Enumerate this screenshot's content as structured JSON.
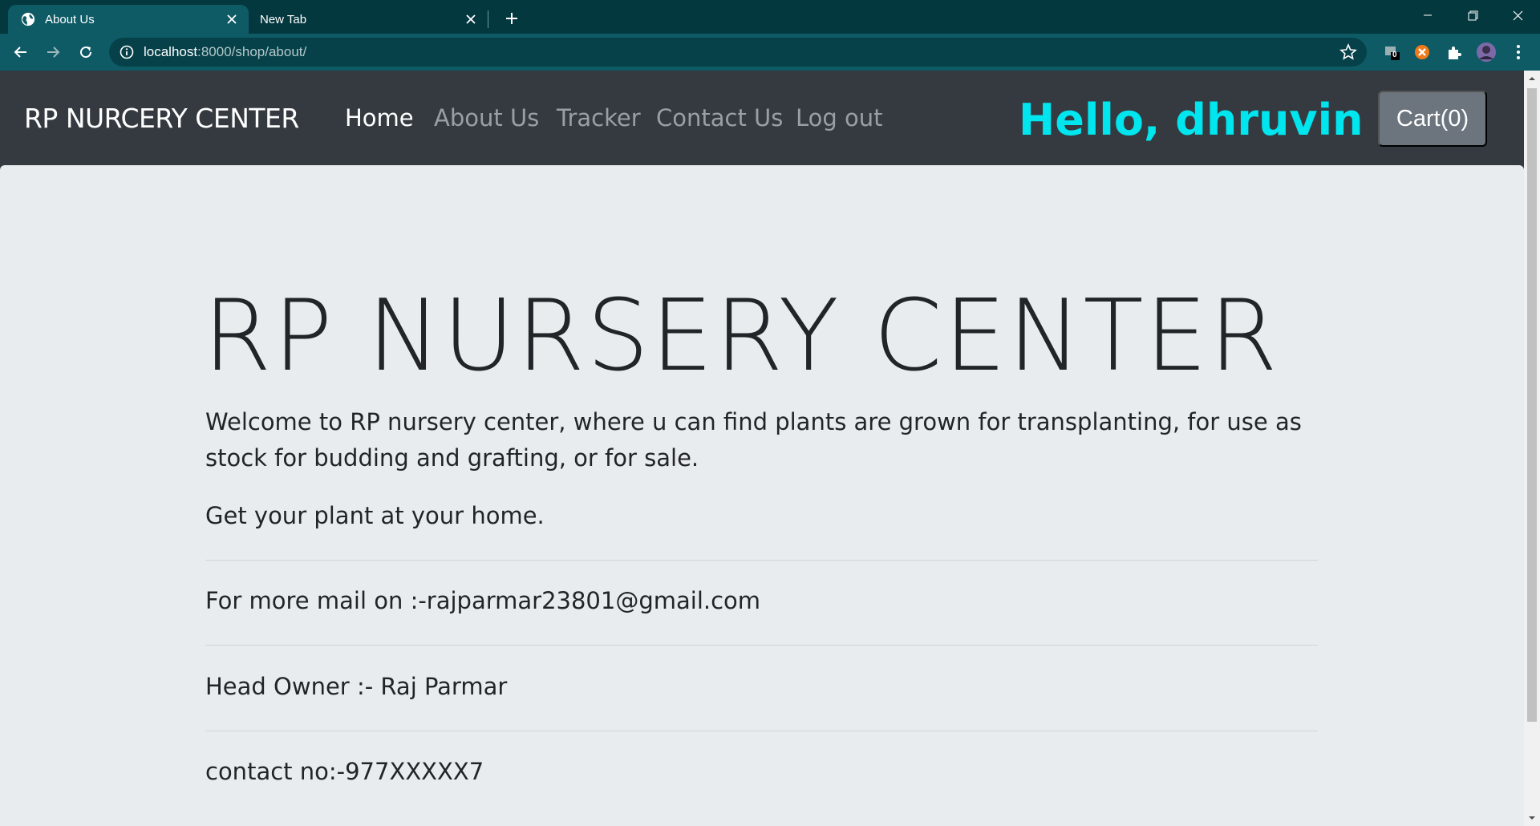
{
  "browser": {
    "tabs": [
      {
        "title": "About Us",
        "active": true
      },
      {
        "title": "New Tab",
        "active": false
      }
    ],
    "url_host": "localhost",
    "url_path": ":8000/shop/about/",
    "extension_badge": "0",
    "accent_color": "#0e5b66"
  },
  "site": {
    "brand": "RP NURCERY CENTER",
    "nav": [
      {
        "label": "Home",
        "active": true
      },
      {
        "label": "About Us",
        "active": false
      },
      {
        "label": "Tracker",
        "active": false
      },
      {
        "label": "Contact Us",
        "active": false
      },
      {
        "label": "Log out",
        "active": false
      }
    ],
    "greeting": "Hello, dhruvin",
    "greeting_color": "#00e5ee",
    "cart_label": "Cart(0)"
  },
  "content": {
    "heading": "RP NURSERY CENTER",
    "lead": "Welcome to RP nursery center, where u can find plants are grown for transplanting, for use as stock for budding and grafting, or for sale.",
    "tagline": "Get your plant at your home.",
    "email_line": "For more mail on :-rajparmar23801@gmail.com",
    "owner_line": "Head Owner :- Raj Parmar",
    "contact_line": "contact no:-977XXXXX7"
  }
}
